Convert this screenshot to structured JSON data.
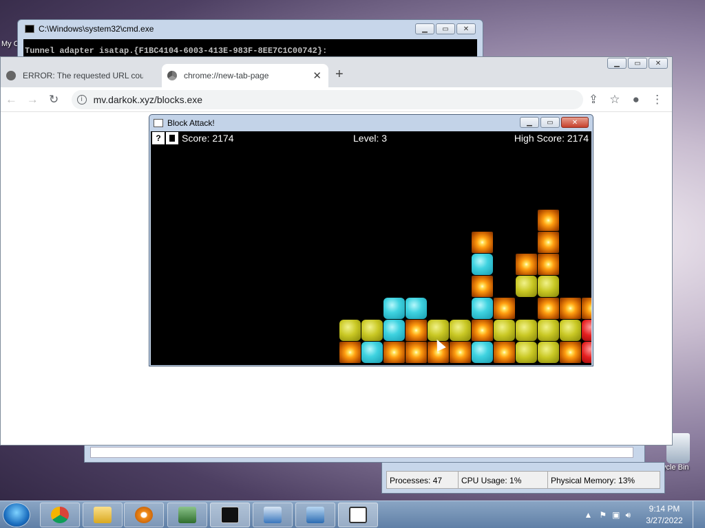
{
  "desktop": {
    "icon_left_label": "My C",
    "icon_right_label": "ycle Bin"
  },
  "cmd": {
    "title": "C:\\Windows\\system32\\cmd.exe",
    "line": "Tunnel adapter isatap.{F1BC4104-6003-413E-983F-8EE7C1C00742}:"
  },
  "chrome": {
    "tabs": [
      {
        "label": "ERROR: The requested URL could"
      },
      {
        "label": "chrome://new-tab-page"
      }
    ],
    "url": "mv.darkok.xyz/blocks.exe"
  },
  "game": {
    "title": "Block Attack!",
    "help_label": "?",
    "score": "Score: 2174",
    "level": "Level: 3",
    "high_score": "High Score: 2174"
  },
  "taskmgr": {
    "processes": "Processes: 47",
    "cpu": "CPU Usage: 1%",
    "memory": "Physical Memory: 13%"
  },
  "taskbar": {
    "time": "9:14 PM",
    "date": "3/27/2022"
  },
  "colors": {
    "cyan": "#3fd3e0",
    "yellow": "#c9c824",
    "red": "#e41f1f",
    "blue": "#1a2fe0",
    "star": "#ff9d10"
  }
}
